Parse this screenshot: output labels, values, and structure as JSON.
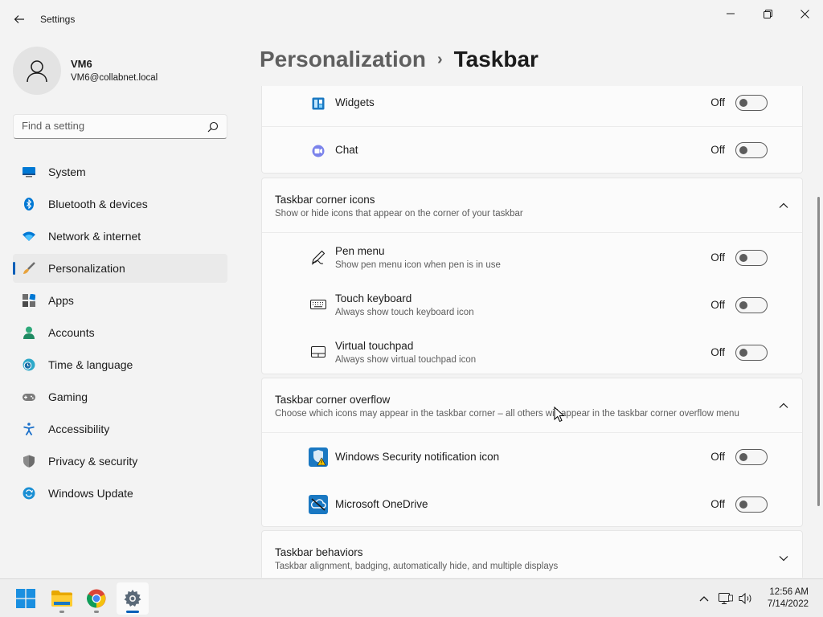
{
  "window": {
    "title": "Settings"
  },
  "profile": {
    "name": "VM6",
    "email": "VM6@collabnet.local"
  },
  "search": {
    "placeholder": "Find a setting"
  },
  "sidebar": {
    "items": [
      {
        "label": "System",
        "icon": "system-icon"
      },
      {
        "label": "Bluetooth & devices",
        "icon": "bluetooth-icon"
      },
      {
        "label": "Network & internet",
        "icon": "wifi-icon"
      },
      {
        "label": "Personalization",
        "icon": "brush-icon",
        "active": true
      },
      {
        "label": "Apps",
        "icon": "apps-icon"
      },
      {
        "label": "Accounts",
        "icon": "accounts-icon"
      },
      {
        "label": "Time & language",
        "icon": "clock-globe-icon"
      },
      {
        "label": "Gaming",
        "icon": "gamepad-icon"
      },
      {
        "label": "Accessibility",
        "icon": "accessibility-icon"
      },
      {
        "label": "Privacy & security",
        "icon": "shield-icon"
      },
      {
        "label": "Windows Update",
        "icon": "update-icon"
      }
    ]
  },
  "breadcrumb": {
    "parent": "Personalization",
    "separator": "›",
    "current": "Taskbar"
  },
  "taskbar_items": {
    "widgets": {
      "title": "Widgets",
      "state": "Off",
      "on": false
    },
    "chat": {
      "title": "Chat",
      "state": "Off",
      "on": false
    }
  },
  "corner_icons": {
    "title": "Taskbar corner icons",
    "description": "Show or hide icons that appear on the corner of your taskbar",
    "expanded": true,
    "items": [
      {
        "title": "Pen menu",
        "description": "Show pen menu icon when pen is in use",
        "state": "Off",
        "on": false
      },
      {
        "title": "Touch keyboard",
        "description": "Always show touch keyboard icon",
        "state": "Off",
        "on": false
      },
      {
        "title": "Virtual touchpad",
        "description": "Always show virtual touchpad icon",
        "state": "Off",
        "on": false
      }
    ]
  },
  "corner_overflow": {
    "title": "Taskbar corner overflow",
    "description": "Choose which icons may appear in the taskbar corner – all others will appear in the taskbar corner overflow menu",
    "expanded": true,
    "items": [
      {
        "title": "Windows Security notification icon",
        "state": "Off",
        "on": false
      },
      {
        "title": "Microsoft OneDrive",
        "state": "Off",
        "on": false
      }
    ]
  },
  "behaviors": {
    "title": "Taskbar behaviors",
    "description": "Taskbar alignment, badging, automatically hide, and multiple displays",
    "expanded": false
  },
  "system_taskbar": {
    "apps": [
      "windows-start-icon",
      "file-explorer-icon",
      "chrome-icon",
      "settings-icon"
    ],
    "active_app": "settings-icon",
    "time": "12:56 AM",
    "date": "7/14/2022"
  },
  "colors": {
    "accent": "#005fb8",
    "background": "#f3f3f3",
    "card": "#fbfbfb"
  }
}
